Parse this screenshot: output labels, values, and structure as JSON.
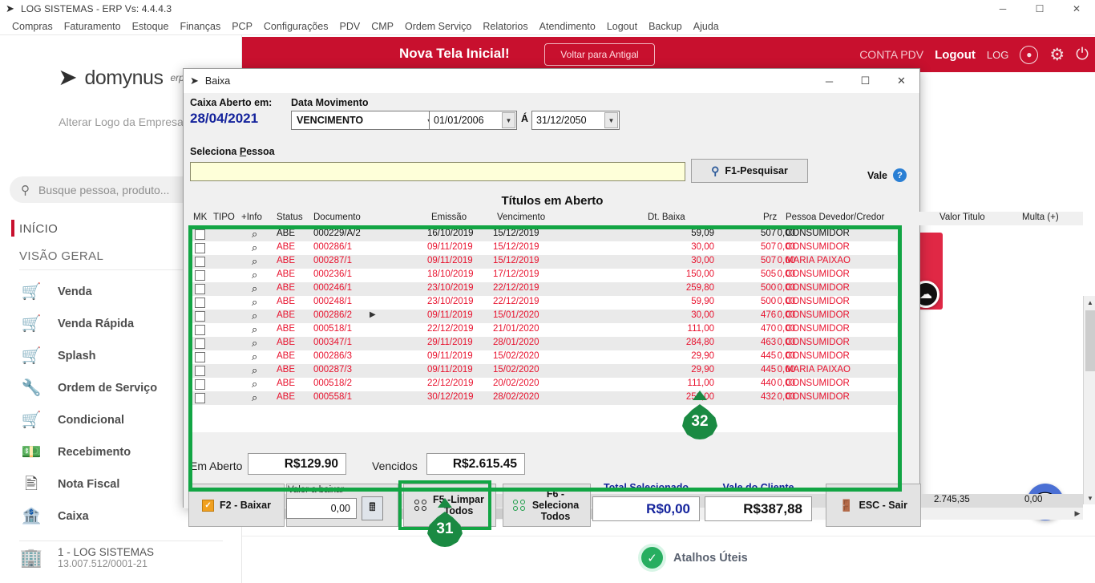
{
  "window": {
    "title": "LOG SISTEMAS - ERP Vs: 4.4.4.3",
    "minimize": "─",
    "maximize": "☐",
    "close": "✕"
  },
  "menubar": {
    "items": [
      "Compras",
      "Faturamento",
      "Estoque",
      "Finanças",
      "PCP",
      "Configurações",
      "PDV",
      "CMP",
      "Ordem Serviço",
      "Relatorios",
      "Atendimento",
      "Logout",
      "Backup",
      "Ajuda"
    ]
  },
  "banner": {
    "title": "Nova Tela Inicial!",
    "old_button": "Voltar para Antigal",
    "conta_pdv": "CONTA PDV",
    "logout": "Logout",
    "log": "LOG",
    "color": "#c8102e"
  },
  "sidebar": {
    "logo_text": "domynus",
    "logo_sup": "erp",
    "alter_logo": "Alterar Logo da Empresa",
    "search_placeholder": "Busque pessoa, produto...",
    "nav_top": [
      {
        "label": "INÍCIO",
        "active": true
      },
      {
        "label": "VISÃO GERAL",
        "active": false
      }
    ],
    "items": [
      {
        "label": "Venda",
        "icon": "cart-icon"
      },
      {
        "label": "Venda Rápida",
        "icon": "cart-fast-icon"
      },
      {
        "label": "Splash",
        "icon": "cart-money-icon"
      },
      {
        "label": "Ordem de Serviço",
        "icon": "wrench-icon"
      },
      {
        "label": "Condicional",
        "icon": "cart-arrow-icon"
      },
      {
        "label": "Recebimento",
        "icon": "hand-money-icon"
      },
      {
        "label": "Nota Fiscal",
        "icon": "nfe-document-icon"
      },
      {
        "label": "Caixa",
        "icon": "cash-register-icon"
      }
    ],
    "company": {
      "name": "1 - LOG SISTEMAS",
      "cnpj": "13.007.512/0001-21"
    }
  },
  "footer": {
    "atalhos": "Atalhos Úteis"
  },
  "dialog": {
    "title": "Baixa",
    "minimize": "─",
    "maximize": "☐",
    "close": "✕",
    "caixa_aberto_label": "Caixa Aberto em:",
    "caixa_aberto_value": "28/04/2021",
    "data_movimento_label": "Data Movimento",
    "movimento_selected": "VENCIMENTO",
    "date_from": "01/01/2006",
    "date_to": "31/12/2050",
    "date_sep": "Á",
    "seleciona_pessoa_label_pre": "Seleciona ",
    "seleciona_pessoa_label_key": "P",
    "seleciona_pessoa_label_post": "essoa",
    "pessoa_value": "",
    "search_button": "F1-Pesquisar",
    "vale_label": "Vale",
    "vale_help": "?",
    "grid_title": "Títulos em Aberto",
    "columns": [
      "MK",
      "TIPO",
      "+Info",
      "Status",
      "Documento",
      "Emissão",
      "Vencimento",
      "Dt. Baixa",
      "Prz",
      "Pessoa Devedor/Credor",
      "Valor Titulo",
      "Multa (+)"
    ],
    "rows": [
      {
        "status": "ABE",
        "documento": "000229/A/2",
        "emissao": "16/10/2019",
        "vencimento": "15/12/2019",
        "dt_baixa": "",
        "prz": "507",
        "pessoa": "CONSUMIDOR",
        "valor": "59,09",
        "multa": "0,00",
        "overdue": false
      },
      {
        "status": "ABE",
        "documento": "000286/1",
        "emissao": "09/11/2019",
        "vencimento": "15/12/2019",
        "dt_baixa": "",
        "prz": "507",
        "pessoa": "CONSUMIDOR",
        "valor": "30,00",
        "multa": "0,00",
        "overdue": true
      },
      {
        "status": "ABE",
        "documento": "000287/1",
        "emissao": "09/11/2019",
        "vencimento": "15/12/2019",
        "dt_baixa": "",
        "prz": "507",
        "pessoa": "MARIA PAIXAO",
        "valor": "30,00",
        "multa": "0,00",
        "overdue": true
      },
      {
        "status": "ABE",
        "documento": "000236/1",
        "emissao": "18/10/2019",
        "vencimento": "17/12/2019",
        "dt_baixa": "",
        "prz": "505",
        "pessoa": "CONSUMIDOR",
        "valor": "150,00",
        "multa": "0,00",
        "overdue": true
      },
      {
        "status": "ABE",
        "documento": "000246/1",
        "emissao": "23/10/2019",
        "vencimento": "22/12/2019",
        "dt_baixa": "",
        "prz": "500",
        "pessoa": "CONSUMIDOR",
        "valor": "259,80",
        "multa": "0,00",
        "overdue": true
      },
      {
        "status": "ABE",
        "documento": "000248/1",
        "emissao": "23/10/2019",
        "vencimento": "22/12/2019",
        "dt_baixa": "",
        "prz": "500",
        "pessoa": "CONSUMIDOR",
        "valor": "59,90",
        "multa": "0,00",
        "overdue": true
      },
      {
        "status": "ABE",
        "documento": "000286/2",
        "emissao": "09/11/2019",
        "vencimento": "15/01/2020",
        "dt_baixa": "",
        "prz": "476",
        "pessoa": "CONSUMIDOR",
        "valor": "30,00",
        "multa": "0,00",
        "overdue": true
      },
      {
        "status": "ABE",
        "documento": "000518/1",
        "emissao": "22/12/2019",
        "vencimento": "21/01/2020",
        "dt_baixa": "",
        "prz": "470",
        "pessoa": "CONSUMIDOR",
        "valor": "111,00",
        "multa": "0,00",
        "overdue": true
      },
      {
        "status": "ABE",
        "documento": "000347/1",
        "emissao": "29/11/2019",
        "vencimento": "28/01/2020",
        "dt_baixa": "",
        "prz": "463",
        "pessoa": "CONSUMIDOR",
        "valor": "284,80",
        "multa": "0,00",
        "overdue": true
      },
      {
        "status": "ABE",
        "documento": "000286/3",
        "emissao": "09/11/2019",
        "vencimento": "15/02/2020",
        "dt_baixa": "",
        "prz": "445",
        "pessoa": "CONSUMIDOR",
        "valor": "29,90",
        "multa": "0,00",
        "overdue": true
      },
      {
        "status": "ABE",
        "documento": "000287/3",
        "emissao": "09/11/2019",
        "vencimento": "15/02/2020",
        "dt_baixa": "",
        "prz": "445",
        "pessoa": "MARIA PAIXAO",
        "valor": "29,90",
        "multa": "0,00",
        "overdue": true
      },
      {
        "status": "ABE",
        "documento": "000518/2",
        "emissao": "22/12/2019",
        "vencimento": "20/02/2020",
        "dt_baixa": "",
        "prz": "440",
        "pessoa": "CONSUMIDOR",
        "valor": "111,00",
        "multa": "0,00",
        "overdue": true
      },
      {
        "status": "ABE",
        "documento": "000558/1",
        "emissao": "30/12/2019",
        "vencimento": "28/02/2020",
        "dt_baixa": "",
        "prz": "432",
        "pessoa": "CONSUMIDOR",
        "valor": "250,00",
        "multa": "0,00",
        "overdue": true
      }
    ],
    "totals": {
      "valor": "2.745,35",
      "multa": "0,00"
    },
    "em_aberto_label": "Em Aberto",
    "em_aberto_value": "R$129.90",
    "vencidos_label": "Vencidos",
    "vencidos_value": "R$2.615.45",
    "buttons": {
      "baixar": "F2 - Baixar",
      "valor_a_baixar_label": "Valor a baixar",
      "valor_a_baixar_value": "0,00",
      "limpar_todos": "F5 -Limpar Todos",
      "seleciona_todos": "F6 - Seleciona Todos",
      "sair": "ESC - Sair"
    },
    "total_selecionado_label": "Total Selecionado",
    "total_selecionado_value": "R$0,00",
    "vale_cliente_label": "Vale do Cliente",
    "vale_cliente_value": "R$387,88"
  },
  "annotations": [
    {
      "id": "31",
      "label": "31"
    },
    {
      "id": "32",
      "label": "32"
    }
  ],
  "colors": {
    "highlight_green": "#12a544",
    "accent_red": "#c8102e",
    "blue_value": "#14239c",
    "overdue_red": "#e8112d"
  }
}
